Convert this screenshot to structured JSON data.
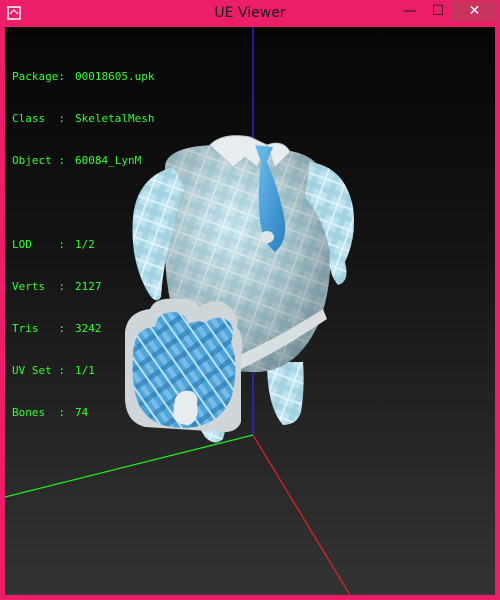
{
  "window": {
    "title": "UE Viewer",
    "minimize_glyph": "—",
    "maximize_glyph": "☐",
    "close_glyph": "✕"
  },
  "info": {
    "package": {
      "label": "Package:",
      "value": "00018605.upk"
    },
    "class": {
      "label": "Class  :",
      "value": "SkeletalMesh"
    },
    "object": {
      "label": "Object :",
      "value": "60084_LynM"
    },
    "lod": {
      "label": "LOD    :",
      "value": "1/2"
    },
    "verts": {
      "label": "Verts  :",
      "value": "2127"
    },
    "tris": {
      "label": "Tris   :",
      "value": "3242"
    },
    "uvset": {
      "label": "UV Set :",
      "value": "1/1"
    },
    "bones": {
      "label": "Bones  :",
      "value": "74"
    }
  },
  "icons": {
    "app": "app-icon",
    "minimize": "minimize-icon",
    "maximize": "maximize-icon",
    "close": "close-icon"
  },
  "colors": {
    "titlebar": "#ec1e6a",
    "info_text": "#33ff33",
    "axis_x": "#ff2020",
    "axis_y": "#20ff20",
    "axis_z": "#2020ff",
    "close_button": "#c7355d"
  }
}
